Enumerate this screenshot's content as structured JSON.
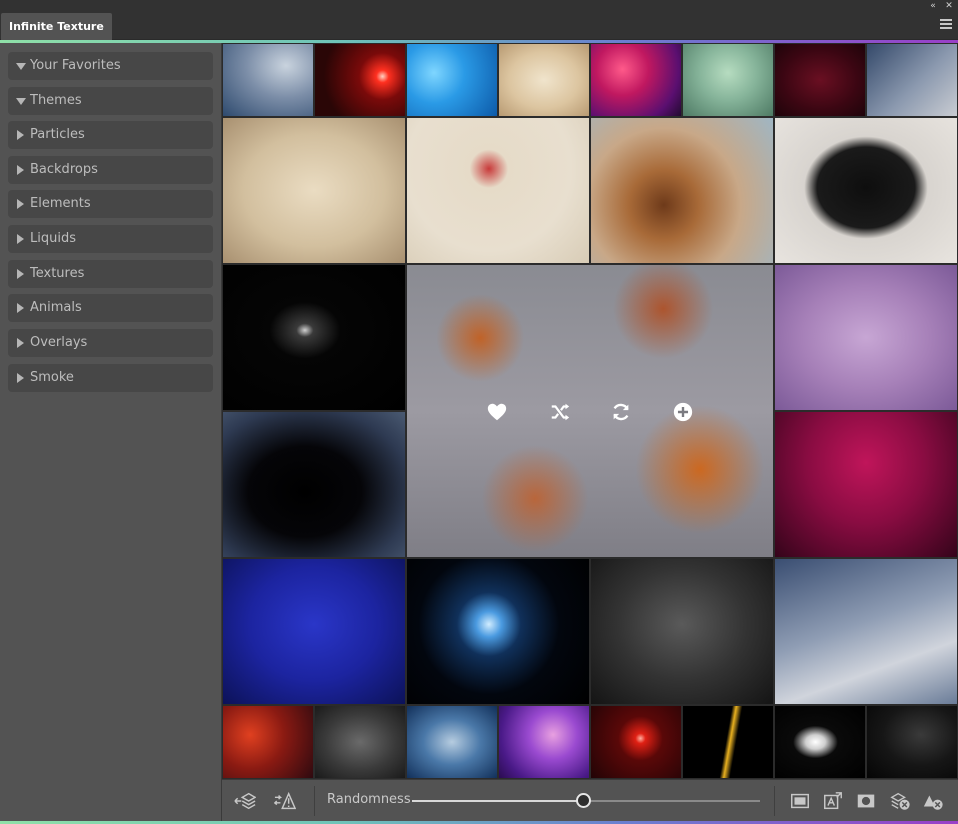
{
  "panel": {
    "tab_title": "Infinite Texture",
    "icons": {
      "collapse": "double-chevron-left-icon",
      "close": "close-icon",
      "menu": "hamburger-menu-icon"
    }
  },
  "sidebar": {
    "items": [
      {
        "label": "Your Favorites",
        "expanded": true
      },
      {
        "label": "Themes",
        "expanded": true
      },
      {
        "label": "Particles",
        "expanded": false
      },
      {
        "label": "Backdrops",
        "expanded": false
      },
      {
        "label": "Elements",
        "expanded": false
      },
      {
        "label": "Liquids",
        "expanded": false
      },
      {
        "label": "Textures",
        "expanded": false
      },
      {
        "label": "Animals",
        "expanded": false
      },
      {
        "label": "Overlays",
        "expanded": false
      },
      {
        "label": "Smoke",
        "expanded": false
      }
    ]
  },
  "featured_tile": {
    "actions": [
      "heart-icon",
      "shuffle-icon",
      "refresh-icon",
      "add-icon"
    ]
  },
  "bottom_bar": {
    "randomness_label": "Randomness",
    "randomness_value": 0.49,
    "left_icons": [
      "add-layer-icon",
      "replace-warning-icon"
    ],
    "right_icons": [
      "fit-canvas-icon",
      "resize-text-icon",
      "mask-icon",
      "clear-layers-icon",
      "clear-styles-icon"
    ]
  },
  "colors": {
    "accent_start": "#8fe0a8",
    "accent_end": "#9a3fc8",
    "panel_bg": "#535353",
    "sidebar_item_bg": "#474747"
  }
}
